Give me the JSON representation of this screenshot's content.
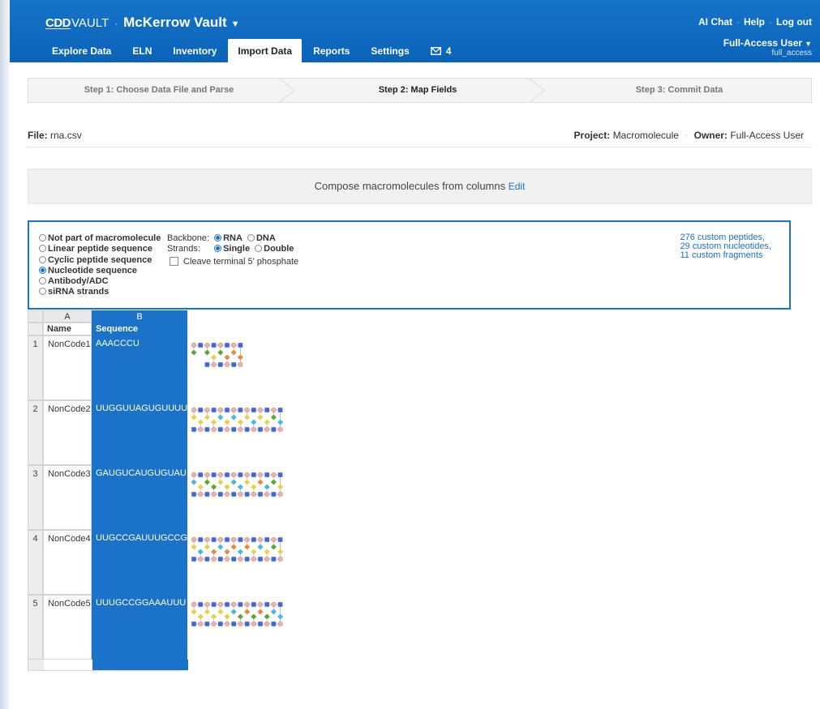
{
  "header": {
    "brand_cdd": "CDD",
    "brand_vault": "VAULT",
    "brand_sep": "·",
    "vault_name": "McKerrow Vault",
    "toplinks": [
      "AI Chat",
      "Help",
      "Log out"
    ],
    "user_name": "Full-Access User",
    "user_login": "full_access"
  },
  "nav": {
    "tabs": [
      "Explore Data",
      "ELN",
      "Inventory",
      "Import Data",
      "Reports",
      "Settings"
    ],
    "active_tab": "Import Data",
    "message_count": "4"
  },
  "steps": [
    "Step 1: Choose Data File and Parse",
    "Step 2: Map Fields",
    "Step 3: Commit Data"
  ],
  "file": {
    "label": "File:",
    "name": "rna.csv",
    "project_label": "Project:",
    "project": "Macromolecule",
    "owner_label": "Owner:",
    "owner": "Full-Access User"
  },
  "compose": {
    "text": "Compose macromolecules from columns",
    "edit_label": "Edit"
  },
  "panel": {
    "radio_options": [
      "Not part of macromolecule",
      "Linear peptide sequence",
      "Cyclic peptide sequence",
      "Nucleotide sequence",
      "Antibody/ADC",
      "siRNA strands"
    ],
    "selected_option": "Nucleotide sequence",
    "backbone_label": "Backbone:",
    "backbone_rna": "RNA",
    "backbone_dna": "DNA",
    "strands_label": "Strands:",
    "strands_single": "Single",
    "strands_double": "Double",
    "cleave_label": "Cleave terminal 5' phosphate",
    "custom_peptides": "276 custom peptides,",
    "custom_nucleotides": "29 custom nucleotides,",
    "custom_fragments": "11 custom fragments"
  },
  "table": {
    "col_letters": [
      "A",
      "B"
    ],
    "col_names": [
      "Name",
      "Sequence"
    ],
    "rows": [
      {
        "num": "1",
        "name": "NonCode1",
        "sequence": "AAACCCU"
      },
      {
        "num": "2",
        "name": "NonCode2",
        "sequence": "UUGGUUAGUGUUUU"
      },
      {
        "num": "3",
        "name": "NonCode3",
        "sequence": "GAUGUCAUGUGUAU"
      },
      {
        "num": "4",
        "name": "NonCode4",
        "sequence": "UUGCCGAUUUGCCG"
      },
      {
        "num": "5",
        "name": "NonCode5",
        "sequence": "UUUGCCGGAAAUUU"
      }
    ]
  },
  "colors": {
    "header_blue": "#1674c8",
    "selection_blue": "#1a73c9",
    "link_blue": "#1a6fc4",
    "base_A": "#5aa832",
    "base_C": "#e8893a",
    "base_G": "#44b8e8",
    "base_U": "#e6d24a",
    "sugar": "#e9b2b2",
    "phosphate": "#3f67d8"
  }
}
